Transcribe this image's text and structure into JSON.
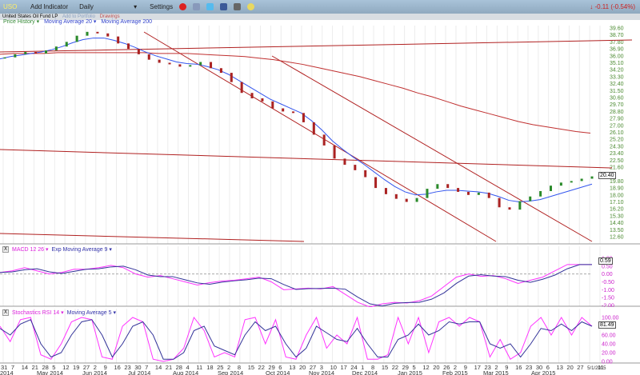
{
  "toolbar": {
    "symbol": "USO",
    "add_indicator": "Add Indicator",
    "interval": "Daily",
    "settings": "Settings",
    "change": "-0.11 (-0.54%)"
  },
  "subbar": {
    "name": "United States Oil Fund LP",
    "add_portfolio": "Add to Portfolio",
    "drawings": "Drawings"
  },
  "legend": {
    "price_history": "Price History ▾",
    "ma20": "Moving Average 20 ▾",
    "ma200": "Moving Average 200"
  },
  "macd": {
    "label": "MACD 12 26 ▾",
    "signal": "Exp Moving Average 9 ▾",
    "value": "0.59",
    "ticks": [
      "1.00",
      "0.50",
      "0.00",
      "-0.50",
      "-1.00",
      "-1.50",
      "-2.00"
    ]
  },
  "stoch": {
    "label": "Stochastics RSI 14 ▾",
    "signal": "Moving Average 5 ▾",
    "value": "81.49",
    "ticks": [
      "100.00",
      "80.00",
      "60.00",
      "40.00",
      "20.00",
      "0.00"
    ]
  },
  "close_label": "20.40",
  "chart_data": {
    "type": "line",
    "title": "USO Daily",
    "yticks": [
      "39.60",
      "38.70",
      "37.80",
      "36.90",
      "36.00",
      "35.10",
      "34.20",
      "33.30",
      "32.40",
      "31.50",
      "30.60",
      "29.70",
      "28.80",
      "27.90",
      "27.00",
      "26.10",
      "25.20",
      "24.30",
      "23.40",
      "22.50",
      "21.60",
      "19.80",
      "18.90",
      "18.00",
      "17.10",
      "16.20",
      "15.30",
      "14.40",
      "13.50",
      "12.60"
    ],
    "ylim": [
      12.6,
      39.6
    ],
    "price": [
      35.8,
      36.2,
      36.5,
      36.3,
      36.7,
      37.2,
      37.8,
      38.6,
      39.1,
      38.9,
      38.5,
      37.6,
      36.9,
      36.2,
      35.5,
      35.1,
      34.9,
      34.6,
      34.8,
      35.2,
      34.4,
      33.8,
      32.6,
      31.2,
      30.5,
      30.1,
      29.2,
      28.8,
      28.6,
      27.4,
      25.8,
      24.4,
      22.7,
      21.9,
      21.2,
      20.3,
      18.9,
      18.1,
      17.5,
      17.1,
      17.6,
      18.8,
      19.4,
      18.9,
      18.4,
      18.0,
      18.3,
      17.6,
      16.4,
      16.1,
      17.2,
      17.8,
      18.5,
      19.2,
      19.6,
      19.8,
      20.1,
      20.4
    ],
    "ma20": [
      35.6,
      35.9,
      36.1,
      36.3,
      36.5,
      36.8,
      37.2,
      37.7,
      38.1,
      38.3,
      38.3,
      38.0,
      37.6,
      37.1,
      36.5,
      36.0,
      35.6,
      35.2,
      35.0,
      34.9,
      34.6,
      34.2,
      33.6,
      32.8,
      32.0,
      31.2,
      30.4,
      29.8,
      29.2,
      28.6,
      27.6,
      26.4,
      25.0,
      23.9,
      22.9,
      22.0,
      21.0,
      20.0,
      19.1,
      18.4,
      18.0,
      18.1,
      18.4,
      18.6,
      18.6,
      18.5,
      18.4,
      18.2,
      17.8,
      17.3,
      17.1,
      17.2,
      17.4,
      17.8,
      18.2,
      18.6,
      19.0,
      19.4
    ],
    "ma200": [
      36.2,
      36.3,
      36.3,
      36.3,
      36.4,
      36.4,
      36.4,
      36.4,
      36.4,
      36.4,
      36.4,
      36.3,
      36.3,
      36.3,
      36.2,
      36.1,
      36.0,
      35.9,
      35.7,
      35.5,
      35.2,
      34.9,
      34.5,
      34.1,
      33.7,
      33.3,
      32.8,
      32.3,
      31.8,
      31.2,
      30.7,
      30.1,
      29.5,
      29.0,
      28.5,
      28.0,
      27.5,
      27.1,
      26.8,
      26.5,
      26.2,
      26.0
    ],
    "xticks": [
      "31",
      "7",
      "14",
      "21",
      "28",
      "5",
      "12",
      "19",
      "27",
      "2",
      "9",
      "16",
      "23",
      "30",
      "7",
      "14",
      "21",
      "28",
      "4",
      "11",
      "18",
      "25",
      "2",
      "8",
      "15",
      "22",
      "29",
      "6",
      "13",
      "20",
      "27",
      "3",
      "10",
      "17",
      "24",
      "1",
      "8",
      "15",
      "22",
      "29",
      "5",
      "12",
      "20",
      "26",
      "2",
      "9",
      "17",
      "23",
      "2",
      "9",
      "16",
      "23",
      "30",
      "6",
      "13",
      "20",
      "27",
      "5/1/2015",
      "11"
    ],
    "months": [
      "2014",
      "May 2014",
      "Jun 2014",
      "Jul 2014",
      "Aug 2014",
      "Sep 2014",
      "Oct 2014",
      "Nov 2014",
      "Dec 2014",
      "Jan 2015",
      "Feb 2015",
      "Mar 2015",
      "Apr 2015"
    ],
    "macd_values": [
      0.1,
      0.2,
      0.4,
      0.2,
      0.0,
      0.1,
      0.3,
      0.3,
      0.4,
      0.55,
      0.4,
      0.0,
      -0.2,
      -0.1,
      -0.3,
      -0.5,
      -0.7,
      -0.55,
      -0.45,
      -0.4,
      -0.3,
      -0.2,
      -0.5,
      -1.0,
      -0.95,
      -0.9,
      -0.95,
      -0.8,
      -1.3,
      -1.8,
      -2.1,
      -1.9,
      -1.8,
      -1.85,
      -1.7,
      -1.4,
      -0.8,
      -0.2,
      0.0,
      -0.15,
      -0.1,
      -0.3,
      -0.6,
      -0.4,
      -0.2,
      0.2,
      0.6,
      0.6,
      0.6
    ],
    "stoch_values": [
      80,
      45,
      95,
      100,
      15,
      5,
      40,
      90,
      100,
      95,
      10,
      5,
      80,
      100,
      90,
      5,
      0,
      5,
      30,
      100,
      70,
      10,
      20,
      10,
      95,
      100,
      40,
      95,
      10,
      5,
      60,
      100,
      30,
      60,
      40,
      100,
      5,
      5,
      15,
      100,
      40,
      100,
      20,
      90,
      100,
      80,
      100,
      90,
      10,
      50,
      5,
      20,
      80,
      100,
      60,
      100,
      60,
      100,
      80
    ],
    "stoch_ma": [
      75,
      60,
      85,
      95,
      40,
      10,
      20,
      60,
      90,
      95,
      60,
      10,
      40,
      80,
      90,
      60,
      5,
      5,
      20,
      70,
      80,
      35,
      25,
      15,
      60,
      90,
      70,
      80,
      40,
      10,
      30,
      80,
      65,
      50,
      45,
      75,
      40,
      10,
      10,
      50,
      60,
      85,
      60,
      70,
      90,
      85,
      90,
      90,
      40,
      30,
      40,
      10,
      40,
      75,
      70,
      85,
      70,
      90,
      80
    ]
  }
}
